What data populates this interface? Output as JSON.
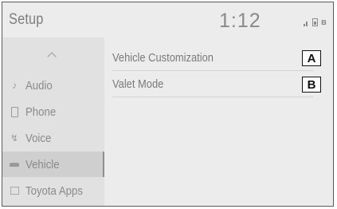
{
  "header": {
    "title": "Setup",
    "clock": "1:12",
    "status_icons": [
      "signal-icon",
      "battery-icon",
      "bluetooth-icon"
    ],
    "bluetooth_glyph": "ʙ"
  },
  "sidebar": {
    "scroll_up_icon": "chevron-up-icon",
    "items": [
      {
        "label": "Audio",
        "icon": "music-note-icon",
        "glyph": "♪",
        "selected": false
      },
      {
        "label": "Phone",
        "icon": "phone-icon",
        "selected": false
      },
      {
        "label": "Voice",
        "icon": "voice-icon",
        "glyph": "↯",
        "selected": false
      },
      {
        "label": "Vehicle",
        "icon": "car-icon",
        "selected": true
      },
      {
        "label": "Toyota Apps",
        "icon": "apps-icon",
        "selected": false
      }
    ]
  },
  "main": {
    "items": [
      {
        "label": "Vehicle Customization",
        "callout": "A"
      },
      {
        "label": "Valet Mode",
        "callout": "B"
      }
    ]
  },
  "colors": {
    "background": "#ececec",
    "sidebar": "#e1e1e1",
    "selected": "#cfcfcf",
    "text": "#8a8a8a"
  }
}
